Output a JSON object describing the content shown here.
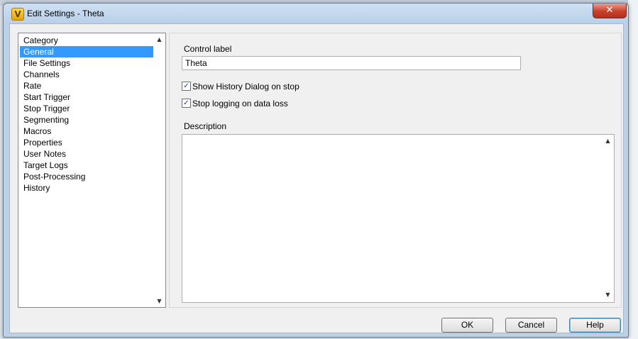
{
  "window": {
    "title": "Edit Settings - Theta",
    "app_icon": "V",
    "close_glyph": "✕"
  },
  "category_list": {
    "items": [
      "Category",
      "General",
      "File Settings",
      "Channels",
      "Rate",
      "Start Trigger",
      "Stop Trigger",
      "Segmenting",
      "Macros",
      "Properties",
      "User Notes",
      "Target Logs",
      "Post-Processing",
      "History"
    ],
    "selected": "General"
  },
  "general": {
    "control_label_caption": "Control label",
    "control_label_value": "Theta",
    "show_history_label": "Show History Dialog on stop",
    "show_history_checked": true,
    "stop_logging_label": "Stop logging on data loss",
    "stop_logging_checked": true,
    "description_caption": "Description",
    "description_value": ""
  },
  "buttons": {
    "ok": "OK",
    "cancel": "Cancel",
    "help": "Help"
  },
  "colors": {
    "selection": "#3399ff",
    "dialog_frame": "#bcd0e6",
    "close_button": "#c7402a"
  }
}
